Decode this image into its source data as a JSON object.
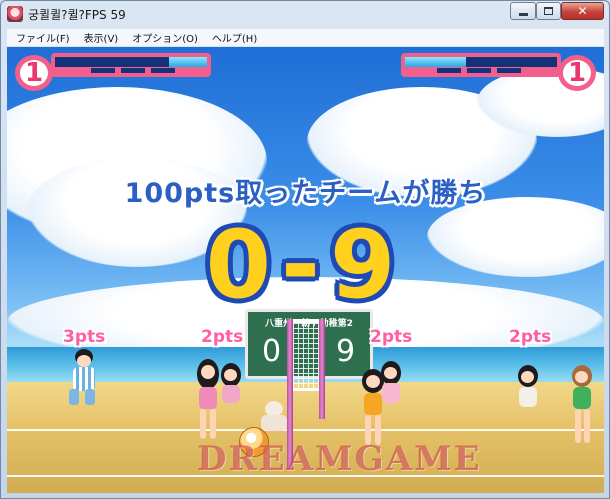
{
  "window": {
    "title": "궁퀼퀼?퀼?FPS  59",
    "colors": {
      "close": "#c7423b",
      "frame": "#c5d6ea"
    }
  },
  "menubar": {
    "items": [
      "ファイル(F)",
      "表示(V)",
      "オプション(O)",
      "ヘルプ(H)"
    ]
  },
  "hud": {
    "left": {
      "number": "1",
      "gauge_fill": 0.25
    },
    "right": {
      "number": "1",
      "gauge_fill": 0.4
    }
  },
  "game": {
    "rule": "100pts取ったチームが勝ち",
    "score_display": "0-9",
    "scoreboard": {
      "label": "八重州一幼 / 幼稚第2",
      "left_score": "0",
      "right_score": "9"
    },
    "player_pts": [
      "3pts",
      "2pts",
      "2pts",
      "2pts"
    ],
    "watermark": "DREAMGAME",
    "colors": {
      "score": "#ffd01e",
      "score_outline": "#1f4ab4",
      "pts": "#ff5fa2",
      "hud": "#f25f8c"
    }
  },
  "icons": [
    "app-icon",
    "minimize-icon",
    "maximize-icon",
    "close-icon",
    "volleyball-icon",
    "net-icon"
  ]
}
